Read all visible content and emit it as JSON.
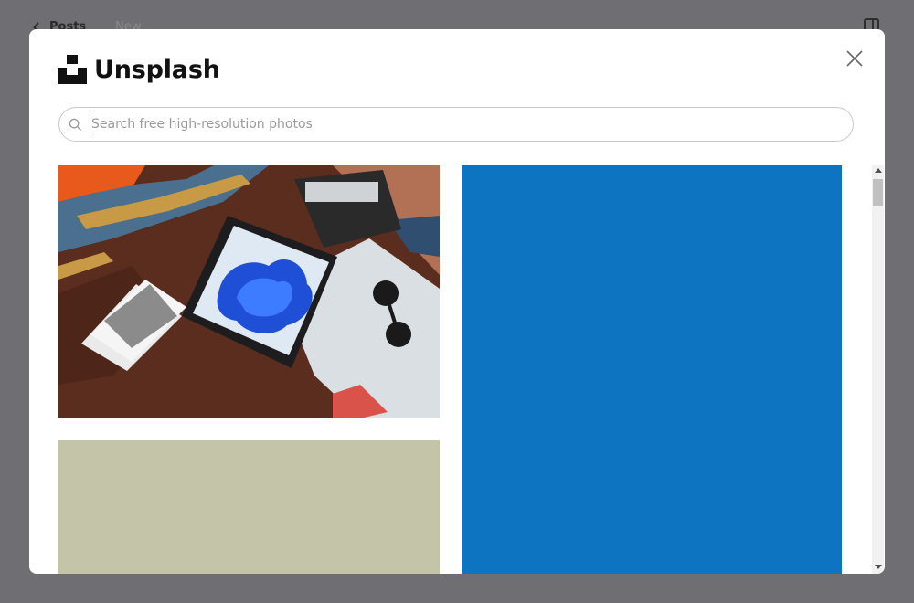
{
  "background": {
    "back_label": "Posts",
    "status_label": "New"
  },
  "modal": {
    "brand_name": "Unsplash",
    "search": {
      "placeholder": "Search free high-resolution photos",
      "value": ""
    },
    "photos": [
      {
        "description": "Laptop with blue Windows wallpaper on a blanket with map, sunglasses and photos",
        "dominant_color": "#5a2e1f"
      },
      {
        "description": "Solid placeholder",
        "dominant_color": "#c3c4a8"
      },
      {
        "description": "Solid placeholder",
        "dominant_color": "#0c74c0"
      }
    ]
  },
  "colors": {
    "overlay": "#6f6f73",
    "placeholder_sage": "#c3c4a8",
    "placeholder_blue": "#0c74c0"
  }
}
